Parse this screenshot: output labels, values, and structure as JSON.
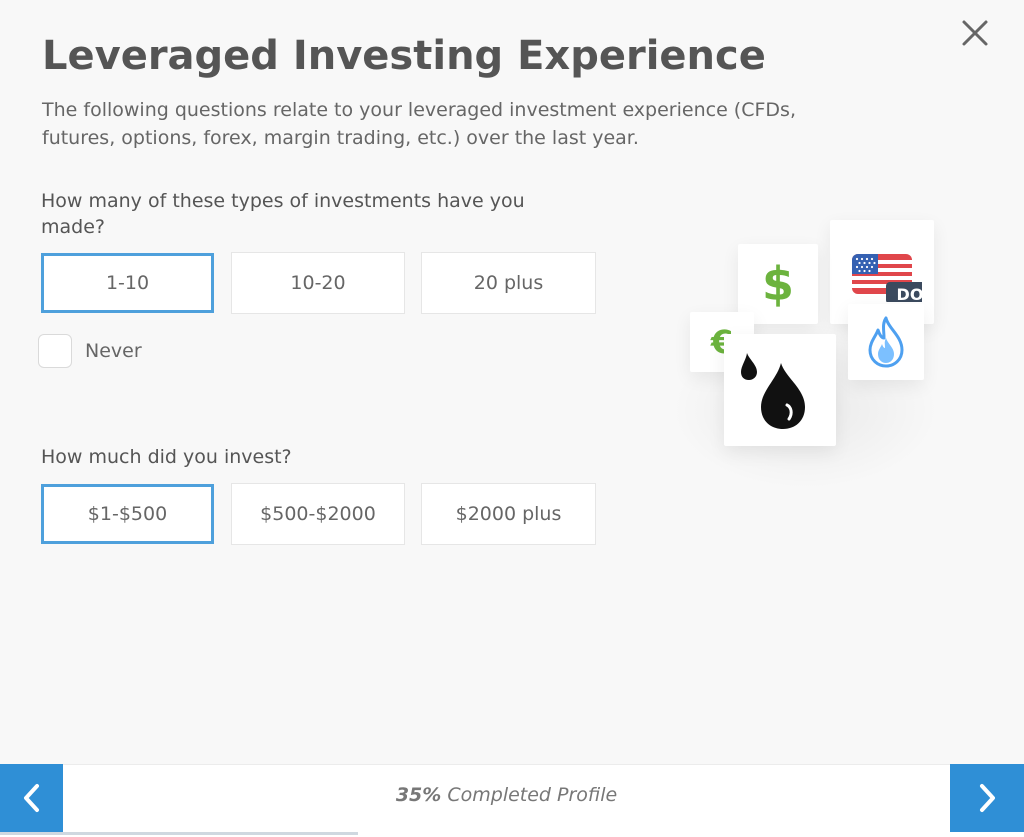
{
  "modal": {
    "title": "Leveraged Investing Experience",
    "subtitle": "The following questions relate to your leveraged investment experience (CFDs, futures, options, forex, margin trading, etc.) over the last year."
  },
  "question1": {
    "text": "How many of these types of investments have you made?",
    "options": [
      {
        "label": "1-10",
        "selected": true
      },
      {
        "label": "10-20",
        "selected": false
      },
      {
        "label": "20 plus",
        "selected": false
      }
    ],
    "never_label": "Never",
    "never_checked": false
  },
  "question2": {
    "text": "How much did you invest?",
    "options": [
      {
        "label": "$1-$500",
        "selected": true
      },
      {
        "label": "$500-$2000",
        "selected": false
      },
      {
        "label": "$2000 plus",
        "selected": false
      }
    ]
  },
  "illustration": {
    "dollar_symbol": "$",
    "euro_symbol": "€",
    "flag_tag": "DO",
    "icons": [
      "dollar-icon",
      "euro-icon",
      "us-flag-icon",
      "flame-icon",
      "oil-drop-icon"
    ]
  },
  "footer": {
    "progress_percent": "35%",
    "progress_label": "Completed Profile",
    "progress_value": 0.35
  },
  "colors": {
    "accent": "#2f8fd6",
    "selected_border": "#4ea0dc",
    "text": "#555555",
    "background": "#f8f8f8",
    "green": "#6cb33e"
  }
}
